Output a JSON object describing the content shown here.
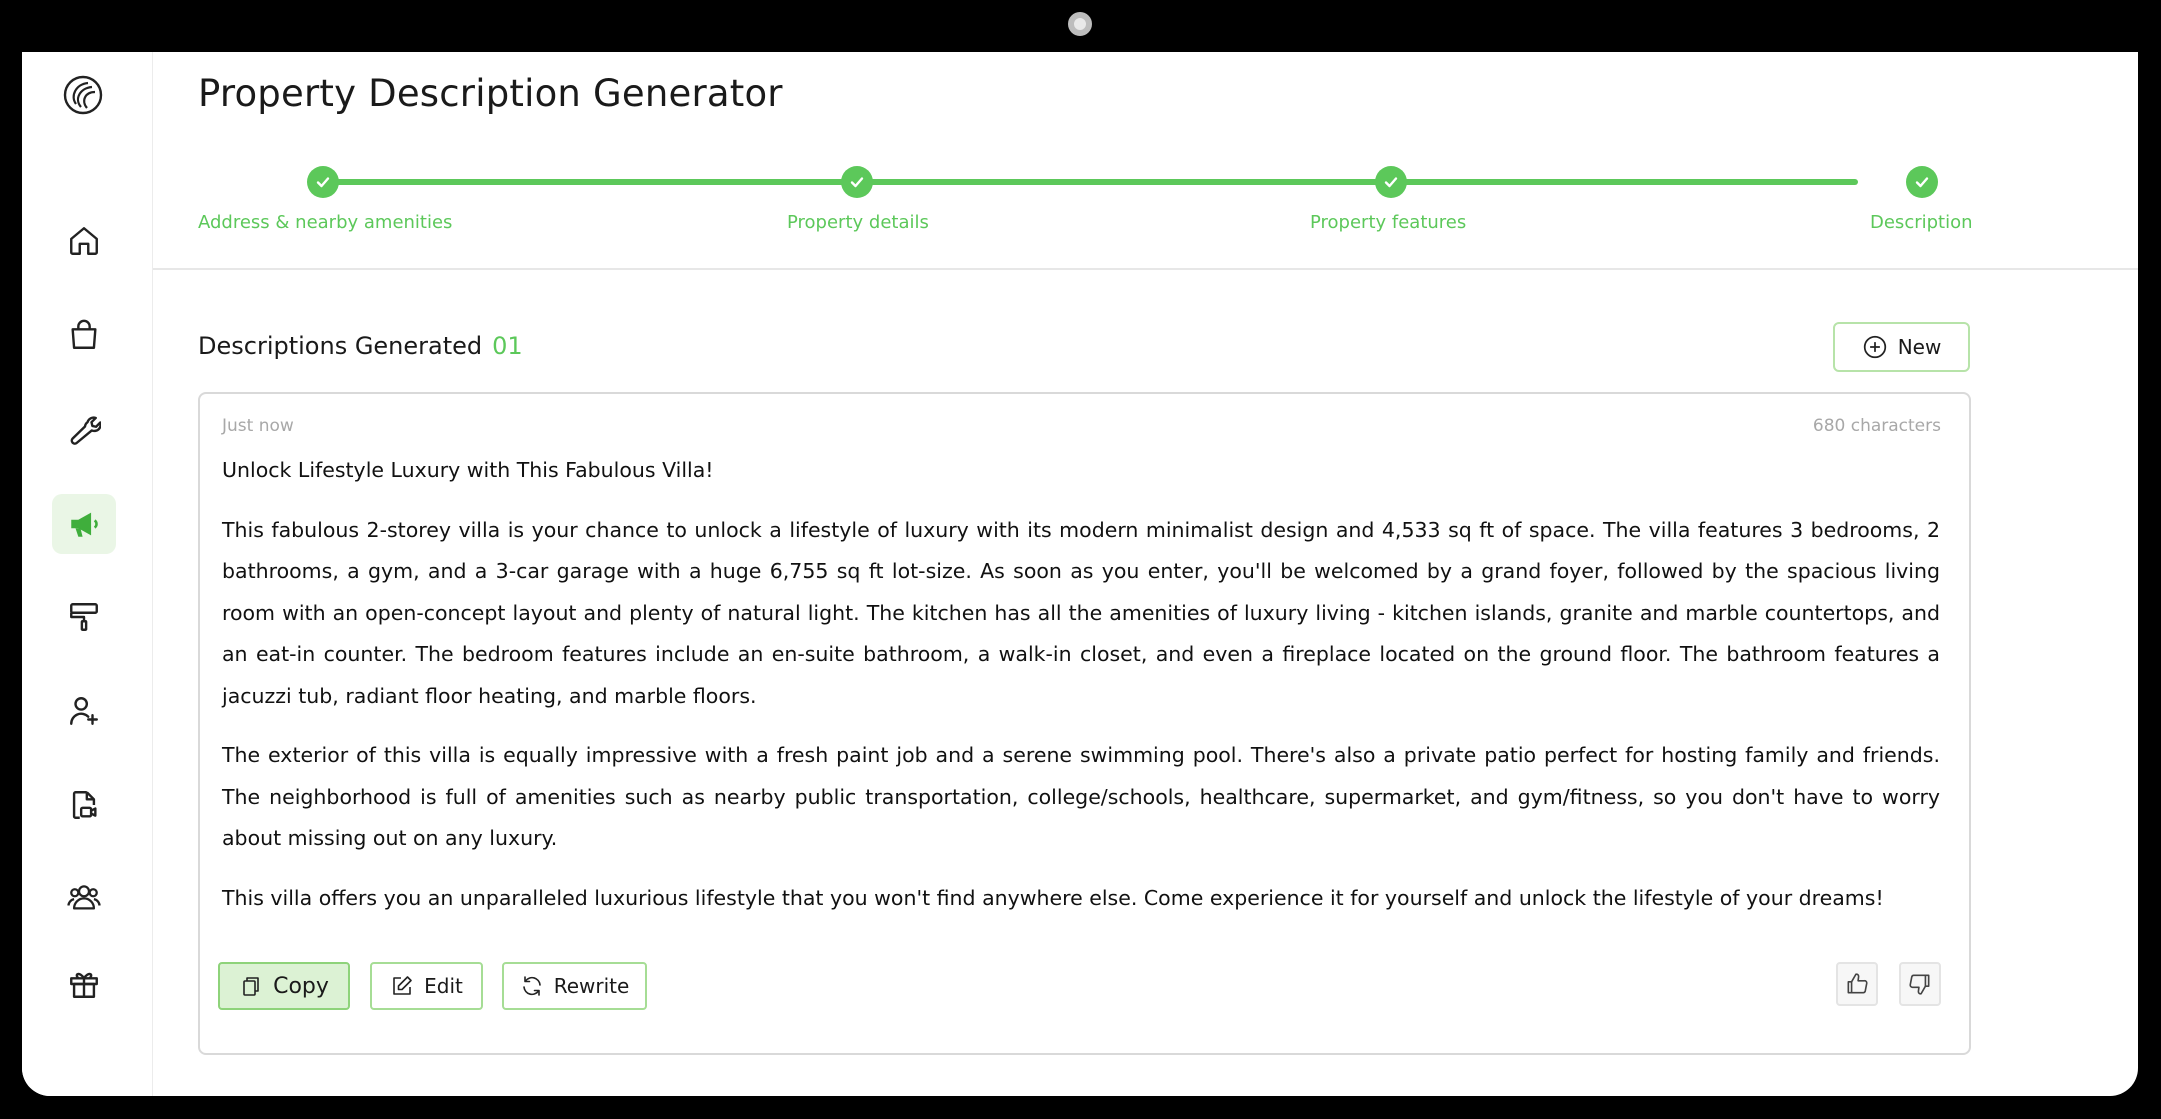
{
  "page": {
    "title": "Property Description Generator"
  },
  "sidebar": {
    "items": [
      {
        "name": "home",
        "icon": "home-icon",
        "active": false
      },
      {
        "name": "bag",
        "icon": "shopping-bag-icon",
        "active": false
      },
      {
        "name": "tools",
        "icon": "wrench-icon",
        "active": false
      },
      {
        "name": "marketing",
        "icon": "megaphone-icon",
        "active": true
      },
      {
        "name": "paint",
        "icon": "paint-roller-icon",
        "active": false
      },
      {
        "name": "add-user",
        "icon": "user-plus-icon",
        "active": false
      },
      {
        "name": "video-file",
        "icon": "file-video-icon",
        "active": false
      },
      {
        "name": "team",
        "icon": "users-icon",
        "active": false
      },
      {
        "name": "gift",
        "icon": "gift-icon",
        "active": false
      }
    ]
  },
  "stepper": {
    "steps": [
      {
        "label": "Address & nearby amenities",
        "completed": true
      },
      {
        "label": "Property details",
        "completed": true
      },
      {
        "label": "Property features",
        "completed": true
      },
      {
        "label": "Description",
        "completed": true
      }
    ]
  },
  "generated": {
    "heading": "Descriptions Generated",
    "count": "01",
    "new_label": "New"
  },
  "card": {
    "time": "Just now",
    "characters": "680 characters",
    "headline": "Unlock Lifestyle Luxury with This Fabulous Villa!",
    "paragraphs": [
      "This fabulous 2-storey villa is your chance to unlock a lifestyle of luxury with its modern minimalist design and 4,533 sq ft of space. The villa features 3 bedrooms, 2 bathrooms, a gym, and a 3-car garage with a huge 6,755 sq ft lot-size. As soon as you enter, you'll be welcomed by a grand foyer, followed by the spacious living room with an open-concept layout and plenty of natural light. The kitchen has all the amenities of luxury living - kitchen islands, granite and marble countertops, and an eat-in counter. The bedroom features include an en-suite bathroom, a walk-in closet, and even a fireplace located on the ground floor. The bathroom features a jacuzzi tub, radiant floor heating, and marble floors.",
      "The exterior of this villa is equally impressive with a fresh paint job and a serene swimming pool. There's also a private patio perfect for hosting family and friends. The neighborhood is full of amenities such as nearby public transportation, college/schools, healthcare, supermarket, and gym/fitness, so you don't have to worry about missing out on any luxury.",
      "This villa offers you an unparalleled luxurious lifestyle that you won't find anywhere else. Come experience it for yourself and unlock the lifestyle of your dreams!"
    ],
    "actions": {
      "copy": "Copy",
      "edit": "Edit",
      "rewrite": "Rewrite"
    }
  },
  "colors": {
    "accent": "#5cc85a",
    "accent_light": "#dcf2d4",
    "border": "#d9d9d9"
  }
}
